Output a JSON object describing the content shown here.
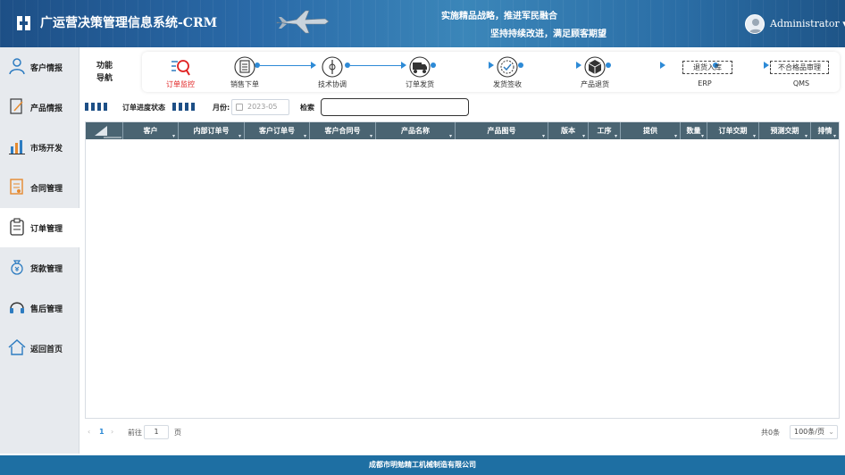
{
  "header": {
    "title": "广运营决策管理信息系统-CRM",
    "slogan_line1": "实施精品战略，推进军民融合",
    "slogan_line2": "坚持持续改进，满足顾客期望",
    "user": "Administrator",
    "user_menu_caret": "▾"
  },
  "sidebar": {
    "items": [
      {
        "label": "客户情报",
        "icon": "user-icon"
      },
      {
        "label": "产品情报",
        "icon": "document-edit-icon"
      },
      {
        "label": "市场开发",
        "icon": "bar-chart-icon"
      },
      {
        "label": "合同管理",
        "icon": "contract-icon"
      },
      {
        "label": "订单管理",
        "icon": "clipboard-icon",
        "active": true
      },
      {
        "label": "货款管理",
        "icon": "money-bag-icon"
      },
      {
        "label": "售后管理",
        "icon": "headset-icon"
      },
      {
        "label": "返回首页",
        "icon": "home-icon"
      }
    ]
  },
  "func_nav": {
    "title": "功能导航",
    "steps": [
      {
        "label": "订单监控",
        "icon": "search-monitor-icon",
        "active": true
      },
      {
        "label": "销售下单",
        "icon": "order-list-icon"
      },
      {
        "label": "技术协调",
        "icon": "tech-coordination-icon"
      },
      {
        "label": "订单发货",
        "icon": "truck-icon"
      },
      {
        "label": "发货签收",
        "icon": "sign-receipt-icon"
      },
      {
        "label": "产品退货",
        "icon": "product-return-icon"
      },
      {
        "label": "ERP",
        "box_label": "退货入库"
      },
      {
        "label": "QMS",
        "box_label": "不合格品审理"
      }
    ]
  },
  "filters": {
    "progress_label": "订单进度状态",
    "month_label": "月份:",
    "month_value": "2023-05",
    "search_label": "检索",
    "search_value": ""
  },
  "grid": {
    "columns": [
      "",
      "客户",
      "内部订单号",
      "客户订单号",
      "客户合同号",
      "产品名称",
      "产品图号",
      "版本",
      "工序",
      "提供",
      "数量",
      "订单交期",
      "预测交期",
      "排情"
    ],
    "rows": []
  },
  "pager": {
    "prev": "‹",
    "current_page": "1",
    "next": "›",
    "goto_label": "前往",
    "goto_value": "1",
    "page_suffix": "页",
    "total_text": "共0条",
    "page_size": "100条/页"
  },
  "footer": {
    "company": "成都市明勉精工机械制造有限公司"
  },
  "colors": {
    "header": "#2a6aa8",
    "accent": "#2d8ad6",
    "grid_header": "#4a6472",
    "active_step": "#e02020",
    "footer": "#1e6fa3"
  }
}
